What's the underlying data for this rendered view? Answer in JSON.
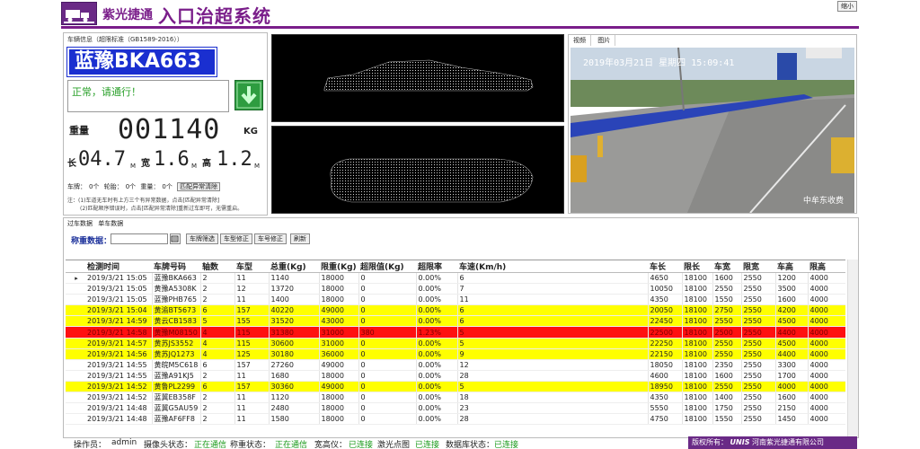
{
  "header": {
    "brand": "紫光捷通",
    "title": "入口治超系统",
    "minimize_label": "缩小"
  },
  "vehicle_info": {
    "title": "车辆信息（超限标准（GB1589-2016））",
    "plate": "蓝豫BKA663",
    "status": "正常，请通行！",
    "weight_label": "重量",
    "weight_value": "001140",
    "weight_unit": "KG",
    "length_label": "长",
    "length_value": "04.7",
    "width_label": "宽",
    "width_value": "1.6",
    "height_label": "高",
    "height_value": "1.2",
    "dim_unit": "M",
    "plate_counter_label": "车牌：",
    "plate_counter": "0个",
    "wheel_counter_label": "轮胎：",
    "wheel_counter": "0个",
    "weigh_counter_label": "重量：",
    "weigh_counter": "0个",
    "clear_button": "匹配异常清除",
    "note1": "注：(1)车道无车时有上方三个有异常数据，点击[匹配异常清除]",
    "note2": "(2)匹配顺序错误时，点击[匹配异常清除]重新过车即可，无需重启。"
  },
  "camera": {
    "tab_video": "视频",
    "tab_image": "图片",
    "timestamp": "2019年03月21日 星期四 15:09:41",
    "watermark": "中牟东收费"
  },
  "data_section": {
    "tab_pass": "过车数据",
    "tab_single": "单车数据",
    "search_label": "称重数据：",
    "search_value": "",
    "btn_filter_plate": "车牌筛选",
    "btn_fix_type": "车型修正",
    "btn_fix_plate": "车号修正",
    "btn_refresh": "刷新"
  },
  "table": {
    "columns": [
      "检测时间",
      "车牌号码",
      "轴数",
      "车型",
      "总重(Kg)",
      "限重(Kg)",
      "超限值(Kg)",
      "超限率",
      "车速(Km/h)",
      "车长",
      "限长",
      "车宽",
      "限宽",
      "车高",
      "限高"
    ],
    "rows": [
      {
        "hl": "",
        "current": true,
        "cells": [
          "2019/3/21 15:05",
          "蓝豫BKA663",
          "2",
          "11",
          "1140",
          "18000",
          "0",
          "0.00%",
          "6",
          "4650",
          "18100",
          "1600",
          "2550",
          "1200",
          "4000"
        ]
      },
      {
        "hl": "",
        "current": false,
        "cells": [
          "2019/3/21 15:05",
          "黄豫A5308K",
          "2",
          "12",
          "13720",
          "18000",
          "0",
          "0.00%",
          "7",
          "10050",
          "18100",
          "2550",
          "2550",
          "3500",
          "4000"
        ]
      },
      {
        "hl": "",
        "current": false,
        "cells": [
          "2019/3/21 15:05",
          "蓝豫PHB765",
          "2",
          "11",
          "1400",
          "18000",
          "0",
          "0.00%",
          "11",
          "4350",
          "18100",
          "1550",
          "2550",
          "1600",
          "4000"
        ]
      },
      {
        "hl": "yellow",
        "current": false,
        "cells": [
          "2019/3/21 15:04",
          "黄渝BT5673",
          "6",
          "157",
          "40220",
          "49000",
          "0",
          "0.00%",
          "6",
          "20050",
          "18100",
          "2750",
          "2550",
          "4200",
          "4000"
        ]
      },
      {
        "hl": "yellow",
        "current": false,
        "cells": [
          "2019/3/21 14:59",
          "黄云CB1583",
          "5",
          "155",
          "31520",
          "43000",
          "0",
          "0.00%",
          "6",
          "22450",
          "18100",
          "2550",
          "2550",
          "4500",
          "4000"
        ]
      },
      {
        "hl": "red",
        "current": false,
        "cells": [
          "2019/3/21 14:58",
          "黄豫M08150",
          "4",
          "115",
          "31380",
          "31000",
          "380",
          "1.23%",
          "5",
          "22500",
          "18100",
          "2500",
          "2550",
          "4400",
          "4000"
        ]
      },
      {
        "hl": "yellow",
        "current": false,
        "cells": [
          "2019/3/21 14:57",
          "黄苏JS3552",
          "4",
          "115",
          "30600",
          "31000",
          "0",
          "0.00%",
          "5",
          "22250",
          "18100",
          "2550",
          "2550",
          "4500",
          "4000"
        ]
      },
      {
        "hl": "yellow",
        "current": false,
        "cells": [
          "2019/3/21 14:56",
          "黄苏JQ1273",
          "4",
          "125",
          "30180",
          "36000",
          "0",
          "0.00%",
          "9",
          "22150",
          "18100",
          "2550",
          "2550",
          "4400",
          "4000"
        ]
      },
      {
        "hl": "",
        "current": false,
        "cells": [
          "2019/3/21 14:55",
          "黄皖M5C618",
          "6",
          "157",
          "27260",
          "49000",
          "0",
          "0.00%",
          "12",
          "18050",
          "18100",
          "2350",
          "2550",
          "3300",
          "4000"
        ]
      },
      {
        "hl": "",
        "current": false,
        "cells": [
          "2019/3/21 14:55",
          "蓝豫A91KJ5",
          "2",
          "11",
          "1680",
          "18000",
          "0",
          "0.00%",
          "28",
          "4600",
          "18100",
          "1600",
          "2550",
          "1700",
          "4000"
        ]
      },
      {
        "hl": "yellow",
        "current": false,
        "cells": [
          "2019/3/21 14:52",
          "黄鲁PL2299",
          "6",
          "157",
          "30360",
          "49000",
          "0",
          "0.00%",
          "5",
          "18950",
          "18100",
          "2550",
          "2550",
          "4000",
          "4000"
        ]
      },
      {
        "hl": "",
        "current": false,
        "cells": [
          "2019/3/21 14:52",
          "蓝冀EB358F",
          "2",
          "11",
          "1120",
          "18000",
          "0",
          "0.00%",
          "18",
          "4350",
          "18100",
          "1400",
          "2550",
          "1600",
          "4000"
        ]
      },
      {
        "hl": "",
        "current": false,
        "cells": [
          "2019/3/21 14:48",
          "蓝冀G5AU59",
          "2",
          "11",
          "2480",
          "18000",
          "0",
          "0.00%",
          "23",
          "5550",
          "18100",
          "1750",
          "2550",
          "2150",
          "4000"
        ]
      },
      {
        "hl": "",
        "current": false,
        "cells": [
          "2019/3/21 14:48",
          "蓝豫AF6FF8",
          "2",
          "11",
          "1580",
          "18000",
          "0",
          "0.00%",
          "28",
          "4750",
          "18100",
          "1550",
          "2550",
          "1450",
          "4000"
        ]
      }
    ]
  },
  "status_bar": {
    "operator_label": "操作员：",
    "operator": "admin",
    "camera_label": "摄像头状态：",
    "camera_status": "正在通信",
    "scale_label": "称重状态：",
    "scale_status": "正在通信",
    "width_label": "宽高仪：",
    "width_status": "已连接",
    "laser_label": "激光点图",
    "laser_status": "已连接",
    "db_label": "数据库状态：",
    "db_status": "已连接",
    "company_label": "版权所有：",
    "company_brand": "UNIS",
    "company_name": "河南紫光捷通有限公司"
  },
  "colors": {
    "brand_purple": "#7a1e8a",
    "plate_blue": "#1a2fd0",
    "pass_green": "#2e9c40",
    "row_yellow": "#ffff00",
    "row_red": "#ff1010"
  },
  "icons": {
    "logo": "truck-scale-icon",
    "pass_signal": "down-arrow-icon",
    "search": "search-icon"
  }
}
